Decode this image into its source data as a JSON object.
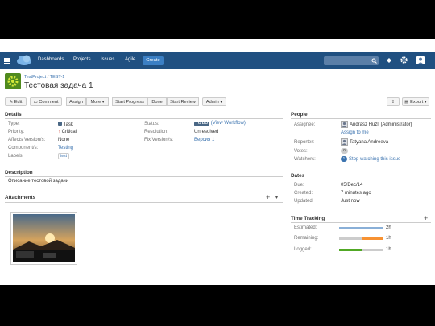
{
  "nav": {
    "items": [
      "Dashboards",
      "Projects",
      "Issues",
      "Agile"
    ],
    "create_label": "Create"
  },
  "issue": {
    "project": "TestProject",
    "key": "TEST-1",
    "title": "Тестовая задача 1"
  },
  "toolbar": {
    "edit": "Edit",
    "comment": "Comment",
    "assign": "Assign",
    "more": "More",
    "start_progress": "Start Progress",
    "done": "Done",
    "start_review": "Start Review",
    "admin": "Admin",
    "export": "Export"
  },
  "details": {
    "heading": "Details",
    "type_label": "Type:",
    "type_value": "Task",
    "priority_label": "Priority:",
    "priority_value": "Critical",
    "affects_label": "Affects Version/s:",
    "affects_value": "None",
    "components_label": "Component/s:",
    "components_value": "Testing",
    "labels_label": "Labels:",
    "labels_value": "test",
    "status_label": "Status:",
    "status_value": "TO DO",
    "view_workflow": "(View Workflow)",
    "resolution_label": "Resolution:",
    "resolution_value": "Unresolved",
    "fix_label": "Fix Version/s:",
    "fix_value": "Версия 1"
  },
  "description": {
    "heading": "Description",
    "text": "Описание тестовой задачи"
  },
  "attachments": {
    "heading": "Attachments"
  },
  "people": {
    "heading": "People",
    "assignee_label": "Assignee:",
    "assignee_value": "Andrasz Huzli [Administrator]",
    "assign_to_me": "Assign to me",
    "reporter_label": "Reporter:",
    "reporter_value": "Tatyana Andreeva",
    "votes_label": "Votes:",
    "votes_value": "0",
    "watchers_label": "Watchers:",
    "watchers_count": "1",
    "watchers_value": "Stop watching this issue"
  },
  "dates": {
    "heading": "Dates",
    "due_label": "Due:",
    "due_value": "05/Dec/14",
    "created_label": "Created:",
    "created_value": "7 minutes ago",
    "updated_label": "Updated:",
    "updated_value": "Just now"
  },
  "time_tracking": {
    "heading": "Time Tracking",
    "estimated_label": "Estimated:",
    "estimated_value": "2h",
    "remaining_label": "Remaining:",
    "remaining_value": "1h",
    "logged_label": "Logged:",
    "logged_value": "1h",
    "estimated_fraction": 1.0,
    "remaining_fraction": 0.5,
    "logged_fraction": 0.5
  },
  "colors": {
    "navbar": "#205081",
    "create": "#3b7fc4",
    "status_badge": "#4a6785",
    "estimated": "#89afd7",
    "remaining": "#f79232",
    "logged": "#51a825"
  }
}
